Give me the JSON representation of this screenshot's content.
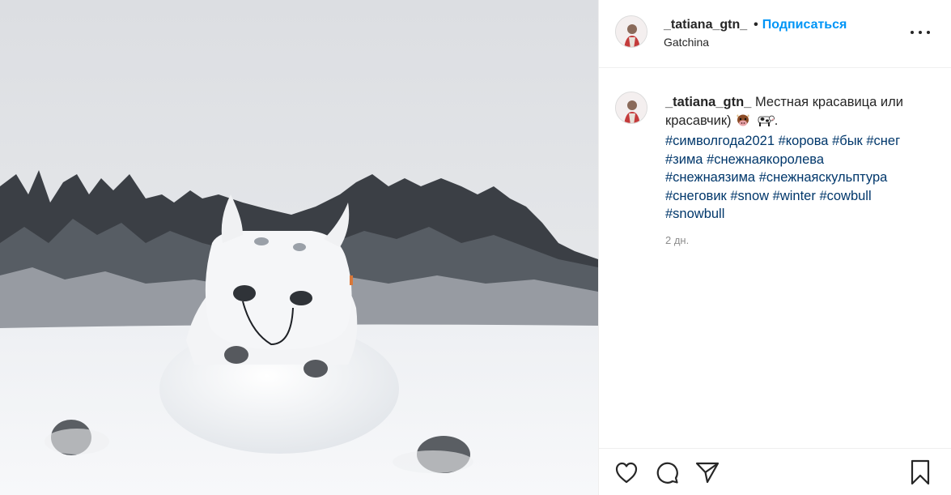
{
  "post": {
    "username": "_tatiana_gtn_",
    "separator": "•",
    "follow_label": "Подписаться",
    "location": "Gatchina",
    "more_icon": "more-horizontal-icon"
  },
  "caption": {
    "username": "_tatiana_gtn_",
    "text": "Местная красавица или красавчик)",
    "emojis": [
      "cow-face-emoji",
      "cow-emoji"
    ],
    "text_end": ".",
    "hashtags": [
      "#символгода2021",
      "#корова",
      "#бык",
      "#снег",
      "#зима",
      "#снежнаякоролева",
      "#снежнаязима",
      "#снежнаяскульптура",
      "#снеговик",
      "#snow",
      "#winter",
      "#cowbull",
      "#snowbull"
    ],
    "time_ago": "2 дн."
  },
  "actions": {
    "like_icon": "heart-icon",
    "comment_icon": "comment-icon",
    "share_icon": "paper-plane-icon",
    "save_icon": "bookmark-icon"
  },
  "colors": {
    "follow": "#0095f6",
    "hashtag": "#00376b",
    "text": "#262626",
    "muted": "#8e8e8e",
    "border": "#efefef"
  }
}
